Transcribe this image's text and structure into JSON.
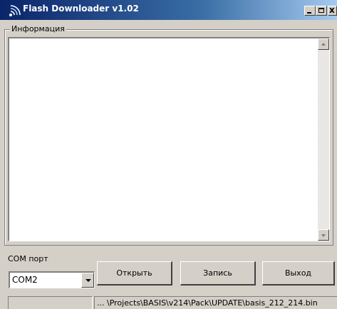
{
  "window": {
    "title": "Flash Downloader v1.02",
    "icon": "signal-waves-icon",
    "controls": {
      "minimize": "_",
      "maximize": "□",
      "close": "x"
    }
  },
  "info_group": {
    "label": "Информация",
    "text": ""
  },
  "com_port": {
    "label": "COM порт",
    "value": "COM2"
  },
  "buttons": {
    "open": "Открыть",
    "write": "Запись",
    "exit": "Выход"
  },
  "status_bar": {
    "left": "",
    "file_path": "... \\Projects\\BASIS\\v214\\Pack\\UPDATE\\basis_212_214.bin"
  },
  "colors": {
    "titlebar_start": "#0a246a",
    "titlebar_end": "#a6caf0",
    "face": "#d4d0c8"
  }
}
